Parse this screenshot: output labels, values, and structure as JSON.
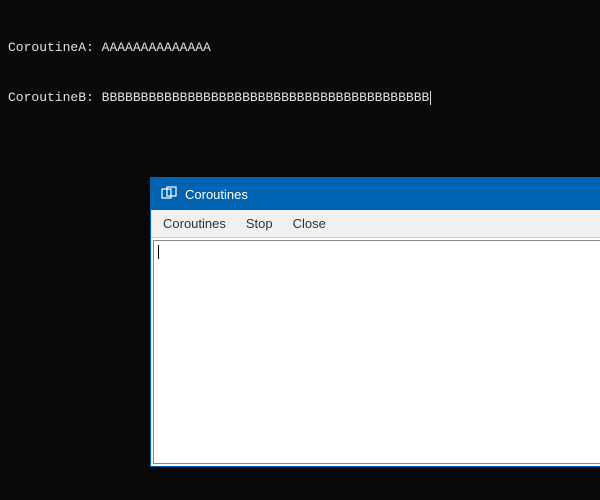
{
  "terminal": {
    "lines": [
      {
        "label": "CoroutineA:",
        "output": "AAAAAAAAAAAAAA"
      },
      {
        "label": "CoroutineB:",
        "output": "BBBBBBBBBBBBBBBBBBBBBBBBBBBBBBBBBBBBBBBBBB"
      }
    ]
  },
  "window": {
    "title": "Coroutines",
    "menu": {
      "coroutines": "Coroutines",
      "stop": "Stop",
      "close": "Close"
    },
    "content": ""
  },
  "colors": {
    "titlebar": "#0063b1",
    "terminal_bg": "#0a0a0a",
    "terminal_fg": "#e0e0e0"
  }
}
